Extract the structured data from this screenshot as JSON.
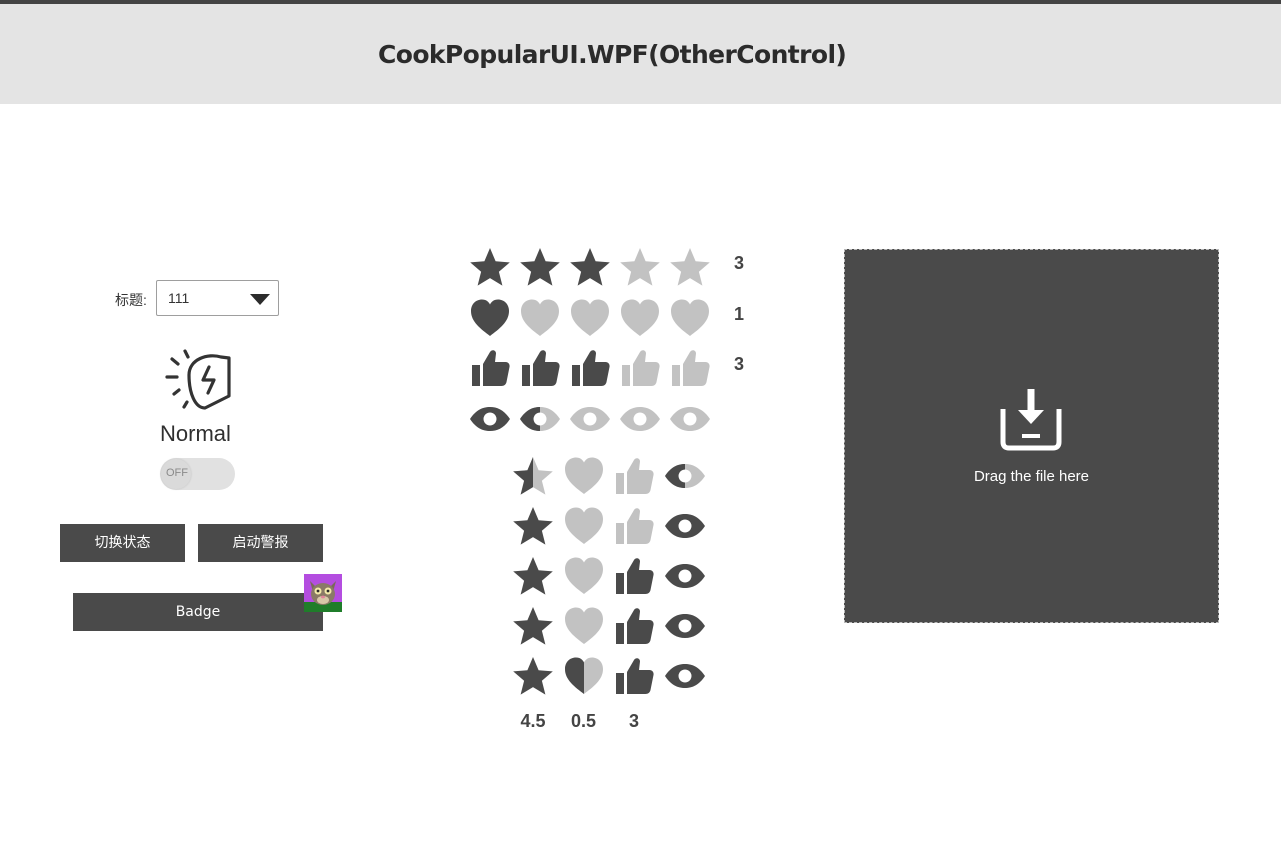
{
  "header": {
    "title": "CookPopularUI.WPF(OtherControl)"
  },
  "form": {
    "label": "标题:",
    "combo_value": "111"
  },
  "alarm": {
    "state_text": "Normal",
    "toggle_text": "OFF",
    "toggle_on": false
  },
  "buttons": {
    "switch_state": "切换状态",
    "start_alarm": "启动警报",
    "badge": "Badge"
  },
  "colors": {
    "filled": "#4a4a4a",
    "empty": "#c2c2c2",
    "header_bg": "#e4e4e4",
    "dropzone_bg": "#4a4a4a"
  },
  "ratings_horizontal": [
    {
      "icon": "star",
      "count": 5,
      "value": 3,
      "value_label": "3"
    },
    {
      "icon": "heart",
      "count": 5,
      "value": 1,
      "value_label": "1"
    },
    {
      "icon": "thumb",
      "count": 5,
      "value": 3,
      "value_label": "3"
    },
    {
      "icon": "eye",
      "count": 5,
      "value": 1.5,
      "value_label": ""
    }
  ],
  "ratings_vertical": [
    {
      "icon": "star",
      "count": 5,
      "value": 4.5,
      "value_label": "4.5"
    },
    {
      "icon": "heart",
      "count": 5,
      "value": 0.5,
      "value_label": "0.5"
    },
    {
      "icon": "thumb",
      "count": 5,
      "value": 3,
      "value_label": "3"
    },
    {
      "icon": "eye",
      "count": 5,
      "value": 4.5,
      "value_label": ""
    }
  ],
  "dropzone": {
    "text": "Drag the file here"
  }
}
